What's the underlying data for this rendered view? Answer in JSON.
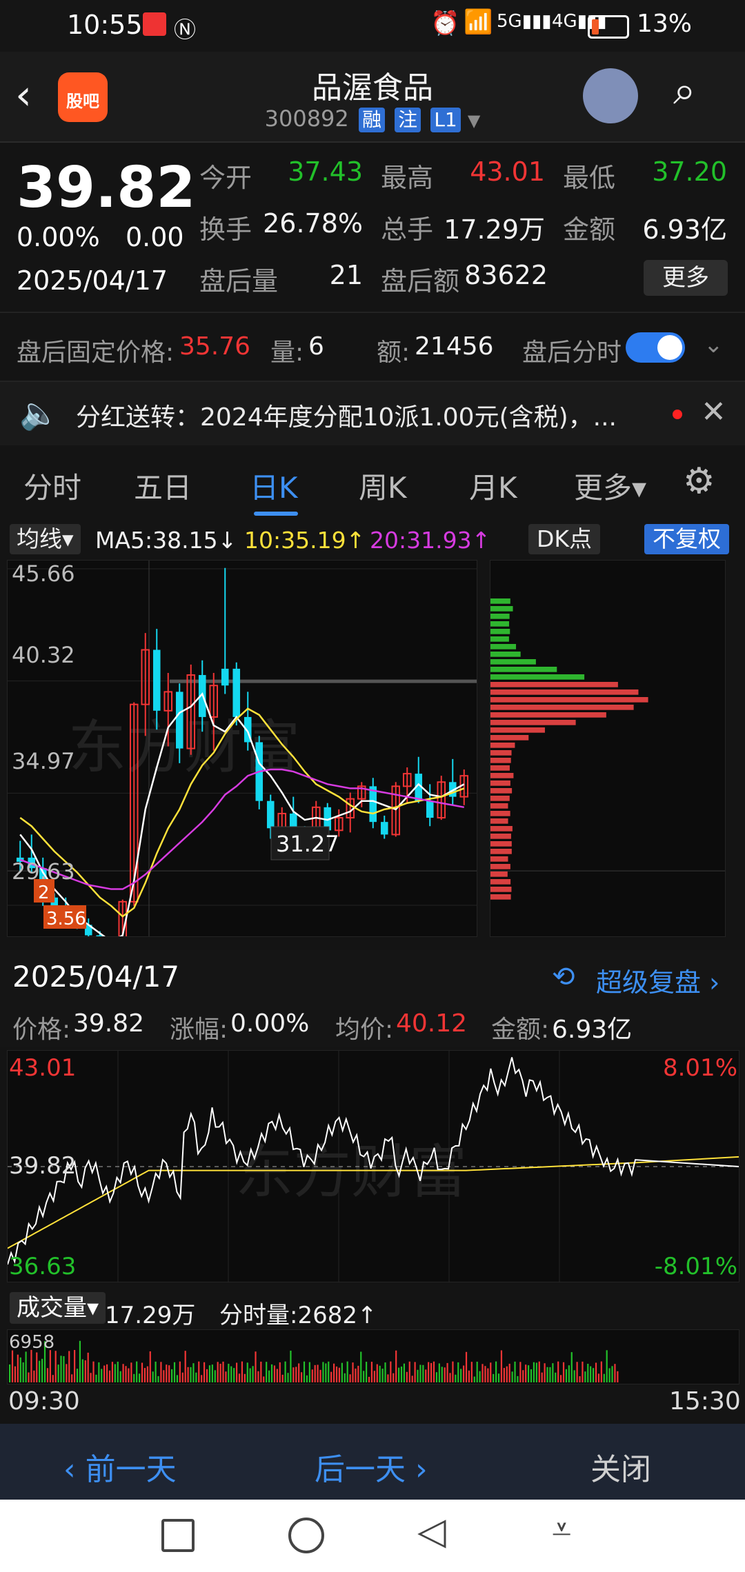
{
  "status": {
    "time": "10:55",
    "battery_pct": "13%"
  },
  "header": {
    "title": "品渥食品",
    "code": "300892",
    "tags": [
      "融",
      "注",
      "L1"
    ],
    "app_badge": "股吧"
  },
  "quote": {
    "price": "39.82",
    "change_pct": "0.00%",
    "change": "0.00",
    "date": "2025/04/17",
    "open_label": "今开",
    "open": "37.43",
    "high_label": "最高",
    "high": "43.01",
    "low_label": "最低",
    "low": "37.20",
    "turnover_label": "换手",
    "turnover": "26.78%",
    "volume_label": "总手",
    "volume": "17.29万",
    "amount_label": "金额",
    "amount": "6.93亿",
    "after_vol_label": "盘后量",
    "after_vol": "21",
    "after_amt_label": "盘后额",
    "after_amt": "83622",
    "more": "更多"
  },
  "afterhours": {
    "fixed_label": "盘后固定价格:",
    "fixed_price": "35.76",
    "qty_label": "量:",
    "qty": "6",
    "amt_label": "额:",
    "amt": "21456",
    "toggle_label": "盘后分时"
  },
  "notice": {
    "text": "分红送转：2024年度分配10派1.00元(含税)，..."
  },
  "tabs": [
    "分时",
    "五日",
    "日K",
    "周K",
    "月K",
    "更多▾"
  ],
  "ma": {
    "chip": "均线▾",
    "ma5": "MA5:38.15↓",
    "ma10": "10:35.19↑",
    "ma20": "20:31.93↑",
    "dk": "DK点",
    "fq": "不复权"
  },
  "kline": {
    "y_labels": [
      "45.66",
      "40.32",
      "34.97",
      "29.63"
    ],
    "cursor_value": "31.27",
    "watermark": "东方财富",
    "marker_labels": [
      "2",
      "3.56"
    ]
  },
  "detail": {
    "date": "2025/04/17",
    "review": "超级复盘 ›",
    "price_label": "价格:",
    "price": "39.82",
    "chg_label": "涨幅:",
    "chg": "0.00%",
    "avg_label": "均价:",
    "avg": "40.12",
    "amt_label": "金额:",
    "amt": "6.93亿"
  },
  "intraday": {
    "top_left": "43.01",
    "mid_left": "39.82",
    "bottom_left": "36.63",
    "top_right": "8.01%",
    "bottom_right": "-8.01%",
    "watermark": "东方财富"
  },
  "volume": {
    "chip": "成交量▾",
    "total": "17.29万",
    "tick_label": "分时量:2682↑",
    "max_label": "6958",
    "start_time": "09:30",
    "end_time": "15:30"
  },
  "footer": {
    "prev": "‹ 前一天",
    "next": "后一天 ›",
    "close": "关闭"
  },
  "chart_data": {
    "type": "candlestick",
    "ylim": [
      29.63,
      45.66
    ],
    "ma_colors": {
      "ma5": "#ffffff",
      "ma10": "#ffe13a",
      "ma20": "#d63be0"
    },
    "candles": [
      [
        31.7,
        32.7,
        31.2,
        31.9,
        "down"
      ],
      [
        31.9,
        33.0,
        31.2,
        31.4,
        "down"
      ],
      [
        31.4,
        31.9,
        29.6,
        30.0,
        "down"
      ],
      [
        30.0,
        30.2,
        29.4,
        29.6,
        "down"
      ],
      [
        29.6,
        30.0,
        28.6,
        29.0,
        "down"
      ],
      [
        29.0,
        29.3,
        28.5,
        28.7,
        "down"
      ],
      [
        28.7,
        29.0,
        28.0,
        28.2,
        "down"
      ],
      [
        28.2,
        28.4,
        27.3,
        27.6,
        "down"
      ],
      [
        27.6,
        28.0,
        27.1,
        27.3,
        "down"
      ],
      [
        27.2,
        29.9,
        27.0,
        29.8,
        "up"
      ],
      [
        29.8,
        39.3,
        29.6,
        39.2,
        "up"
      ],
      [
        39.2,
        42.6,
        37.7,
        41.8,
        "up"
      ],
      [
        41.8,
        42.8,
        38.0,
        38.9,
        "down"
      ],
      [
        38.9,
        40.7,
        37.2,
        39.8,
        "up"
      ],
      [
        39.8,
        40.2,
        36.4,
        37.1,
        "down"
      ],
      [
        37.1,
        41.1,
        36.8,
        40.6,
        "up"
      ],
      [
        40.6,
        41.3,
        37.9,
        38.6,
        "down"
      ],
      [
        38.6,
        40.7,
        37.0,
        40.1,
        "up"
      ],
      [
        40.1,
        45.7,
        39.7,
        40.9,
        "down"
      ],
      [
        40.9,
        41.2,
        38.2,
        38.6,
        "down"
      ],
      [
        38.6,
        39.8,
        37.0,
        37.4,
        "down"
      ],
      [
        37.4,
        37.7,
        34.2,
        34.6,
        "down"
      ],
      [
        34.6,
        34.9,
        32.8,
        33.3,
        "down"
      ],
      [
        33.3,
        34.3,
        32.6,
        34.0,
        "up"
      ],
      [
        34.0,
        34.8,
        32.9,
        33.1,
        "down"
      ],
      [
        33.1,
        33.4,
        32.2,
        32.7,
        "down"
      ],
      [
        32.7,
        34.6,
        32.6,
        34.3,
        "up"
      ],
      [
        34.3,
        34.5,
        32.9,
        33.2,
        "down"
      ],
      [
        33.2,
        34.2,
        32.9,
        33.8,
        "up"
      ],
      [
        33.8,
        35.0,
        33.1,
        34.7,
        "up"
      ],
      [
        34.7,
        35.5,
        34.3,
        35.3,
        "up"
      ],
      [
        35.3,
        35.7,
        33.3,
        33.6,
        "down"
      ],
      [
        33.6,
        33.9,
        32.8,
        33.0,
        "down"
      ],
      [
        33.0,
        35.5,
        32.9,
        35.3,
        "up"
      ],
      [
        35.3,
        36.2,
        34.5,
        35.9,
        "up"
      ],
      [
        35.9,
        36.7,
        34.5,
        34.6,
        "down"
      ],
      [
        34.6,
        35.4,
        33.4,
        33.8,
        "down"
      ],
      [
        33.8,
        35.8,
        33.7,
        35.5,
        "up"
      ],
      [
        35.5,
        36.6,
        34.4,
        34.8,
        "down"
      ],
      [
        34.8,
        36.1,
        34.4,
        35.8,
        "up"
      ]
    ],
    "ma5": [
      33.0,
      32.3,
      31.2,
      30.4,
      29.8,
      29.1,
      28.7,
      28.3,
      27.9,
      28.2,
      30.8,
      34.2,
      36.2,
      38.1,
      38.8,
      39.1,
      39.7,
      38.2,
      37.9,
      38.6,
      37.9,
      36.4,
      35.8,
      35.0,
      34.1,
      33.7,
      33.8,
      33.7,
      33.9,
      34.1,
      34.6,
      34.6,
      34.4,
      34.2,
      34.8,
      35.4,
      34.9,
      34.8,
      35.1,
      35.4
    ],
    "ma10": [
      33.8,
      33.4,
      32.8,
      32.2,
      31.7,
      31.2,
      30.6,
      30.0,
      29.6,
      29.1,
      29.5,
      30.7,
      32.1,
      33.3,
      34.2,
      35.4,
      36.3,
      36.9,
      37.8,
      38.5,
      39.0,
      38.7,
      38.0,
      37.3,
      36.7,
      36.0,
      35.4,
      35.1,
      34.8,
      34.4,
      34.1,
      34.0,
      34.2,
      34.3,
      34.5,
      34.6,
      34.7,
      34.8,
      35.0,
      35.2
    ],
    "ma20": [
      31.8,
      31.6,
      31.4,
      31.2,
      31.0,
      30.8,
      30.6,
      30.5,
      30.4,
      30.4,
      30.7,
      31.1,
      31.6,
      32.1,
      32.6,
      33.1,
      33.6,
      34.2,
      34.9,
      35.3,
      35.8,
      36.0,
      36.1,
      36.1,
      36.0,
      35.8,
      35.6,
      35.4,
      35.3,
      35.2,
      35.2,
      35.1,
      35.0,
      34.9,
      34.8,
      34.7,
      34.6,
      34.5,
      34.4,
      34.3
    ],
    "volume_profile_levels": 40
  }
}
